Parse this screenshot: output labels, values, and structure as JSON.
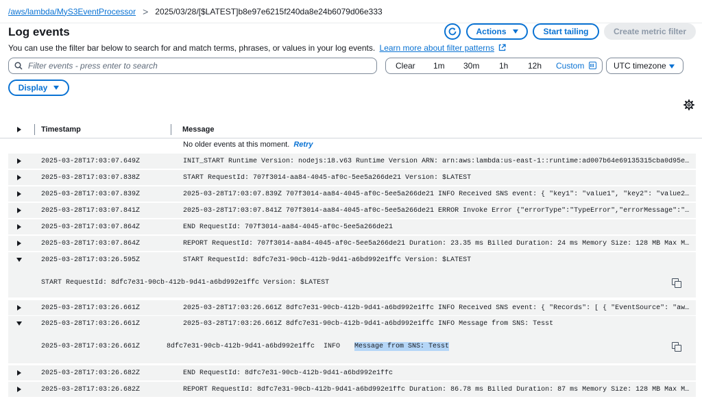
{
  "breadcrumb": {
    "link": "/aws/lambda/MyS3EventProcessor",
    "separator": ">",
    "current": "2025/03/28/[$LATEST]b8e97e6215f240da8e24b6079d06e333"
  },
  "header": {
    "title": "Log events",
    "actions_label": "Actions",
    "start_tailing_label": "Start tailing",
    "create_metric_filter_label": "Create metric filter"
  },
  "description": {
    "text": "You can use the filter bar below to search for and match terms, phrases, or values in your log events.",
    "link": "Learn more about filter patterns"
  },
  "filter": {
    "placeholder": "Filter events - press enter to search"
  },
  "time_range": {
    "clear": "Clear",
    "options": [
      "1m",
      "30m",
      "1h",
      "12h"
    ],
    "custom": "Custom"
  },
  "timezone": "UTC timezone",
  "display_label": "Display",
  "table": {
    "col_timestamp": "Timestamp",
    "col_message": "Message",
    "no_older": "No older events at this moment.",
    "retry": "Retry",
    "rows": [
      {
        "ts": "2025-03-28T17:03:07.649Z",
        "msg": "INIT_START Runtime Version: nodejs:18.v63 Runtime Version ARN: arn:aws:lambda:us-east-1::runtime:ad007b64e69135315cba0d95ed7978…"
      },
      {
        "ts": "2025-03-28T17:03:07.838Z",
        "msg": "START RequestId: 707f3014-aa84-4045-af0c-5ee5a266de21 Version: $LATEST"
      },
      {
        "ts": "2025-03-28T17:03:07.839Z",
        "msg": "2025-03-28T17:03:07.839Z 707f3014-aa84-4045-af0c-5ee5a266de21 INFO Received SNS event: { \"key1\": \"value1\", \"key2\": \"value2\", \"k…"
      },
      {
        "ts": "2025-03-28T17:03:07.841Z",
        "msg": "2025-03-28T17:03:07.841Z 707f3014-aa84-4045-af0c-5ee5a266de21 ERROR Invoke Error {\"errorType\":\"TypeError\",\"errorMessage\":\"event…"
      },
      {
        "ts": "2025-03-28T17:03:07.864Z",
        "msg": "END RequestId: 707f3014-aa84-4045-af0c-5ee5a266de21"
      },
      {
        "ts": "2025-03-28T17:03:07.864Z",
        "msg": "REPORT RequestId: 707f3014-aa84-4045-af0c-5ee5a266de21 Duration: 23.35 ms Billed Duration: 24 ms Memory Size: 128 MB Max Memory…"
      },
      {
        "ts": "2025-03-28T17:03:26.595Z",
        "msg": "START RequestId: 8dfc7e31-90cb-412b-9d41-a6bd992e1ffc Version: $LATEST",
        "expanded": "START RequestId: 8dfc7e31-90cb-412b-9d41-a6bd992e1ffc Version: $LATEST"
      },
      {
        "ts": "2025-03-28T17:03:26.661Z",
        "msg": "2025-03-28T17:03:26.661Z 8dfc7e31-90cb-412b-9d41-a6bd992e1ffc INFO Received SNS event: { \"Records\": [ { \"EventSource\": \"aws:sns…"
      },
      {
        "ts": "2025-03-28T17:03:26.661Z",
        "msg": "2025-03-28T17:03:26.661Z 8dfc7e31-90cb-412b-9d41-a6bd992e1ffc INFO Message from SNS: Tesst",
        "expanded_parts": {
          "ts": "2025-03-28T17:03:26.661Z",
          "id": "8dfc7e31-90cb-412b-9d41-a6bd992e1ffc",
          "level": "INFO",
          "message": "Message from SNS: Tesst"
        }
      },
      {
        "ts": "2025-03-28T17:03:26.682Z",
        "msg": "END RequestId: 8dfc7e31-90cb-412b-9d41-a6bd992e1ffc"
      },
      {
        "ts": "2025-03-28T17:03:26.682Z",
        "msg": "REPORT RequestId: 8dfc7e31-90cb-412b-9d41-a6bd992e1ffc Duration: 86.78 ms Billed Duration: 87 ms Memory Size: 128 MB Max Memory…"
      }
    ]
  }
}
